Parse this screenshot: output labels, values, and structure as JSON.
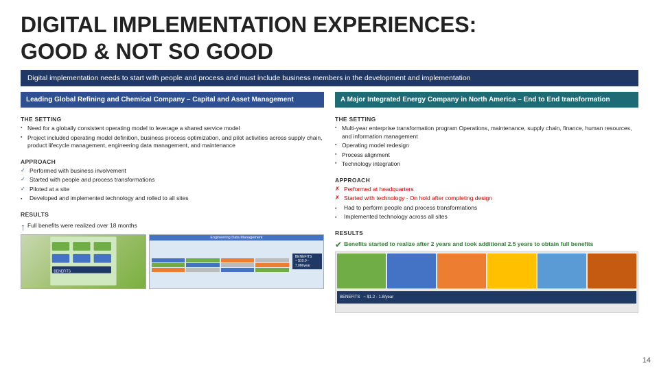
{
  "page": {
    "title_line1": "DIGITAL IMPLEMENTATION EXPERIENCES:",
    "title_line2": "GOOD & NOT SO GOOD",
    "subtitle": "Digital implementation needs to start with people and process and must include business members in the development and implementation",
    "page_number": "14"
  },
  "left_col": {
    "header": "Leading Global Refining and Chemical Company – Capital and Asset Management",
    "setting_label": "THE SETTING",
    "setting_bullets": [
      "Need for a globally consistent operating model to leverage a shared service model",
      "Project included operating model definition, business process optimization, and pilot activities across supply chain, product lifecycle management, engineering data management, and maintenance"
    ],
    "approach_label": "APPROACH",
    "approach_checks": [
      "Performed with business involvement",
      "Started with people and process transformations",
      "Piloted at a site"
    ],
    "approach_bullet": "Developed and implemented technology and rolled to all sites",
    "results_label": "RESULTS",
    "results_text": "Full benefits were realized over 18 months"
  },
  "right_col": {
    "header": "A Major Integrated Energy Company in North America – End to End transformation",
    "setting_label": "THE SETTING",
    "setting_bullets": [
      "Multi-year enterprise transformation program Operations, maintenance, supply chain, finance, human resources, and information management",
      "Operating model redesign",
      "Process alignment",
      "Technology integration"
    ],
    "approach_label": "APPROACH",
    "approach_crosses": [
      "Performed at headquarters",
      "Started with technology - On hold after completing design"
    ],
    "approach_bullets": [
      "Had to perform people and process transformations",
      "Implemented technology across all sites"
    ],
    "results_label": "RESULTS",
    "results_text": "Benefits started to realize after 2 years and took additional 2.5 years to obtain full benefits",
    "img_header": "Engineering Data Management",
    "img_benefits": "~ $10.0 - 7.0M/year",
    "img_benefits_right": "~ $1.2 - 1.8/year"
  }
}
